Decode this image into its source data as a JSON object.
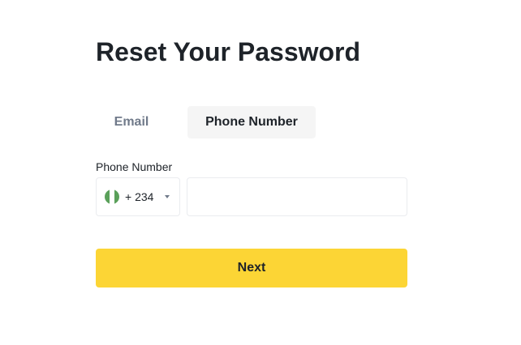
{
  "page": {
    "title": "Reset Your Password"
  },
  "tabs": [
    {
      "label": "Email",
      "active": false
    },
    {
      "label": "Phone Number",
      "active": true
    }
  ],
  "form": {
    "phone_label": "Phone Number",
    "country_code": "+ 234",
    "country_flag_icon": "nigeria-flag-icon",
    "phone_value": "",
    "phone_placeholder": ""
  },
  "actions": {
    "next_label": "Next"
  },
  "colors": {
    "primary_button": "#fcd535",
    "text_primary": "#1e2329",
    "text_muted": "#707a8a",
    "active_tab_bg": "#f5f5f5",
    "input_border": "#eaecef"
  }
}
